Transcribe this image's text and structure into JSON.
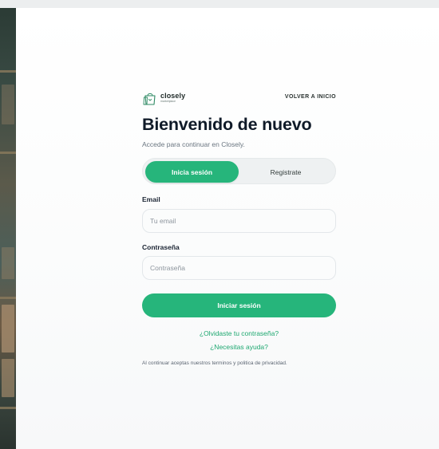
{
  "brand": {
    "name": "closely",
    "tagline": "marketplace",
    "accent_color": "#26b57b",
    "icon": "shopping-bag-icon"
  },
  "header": {
    "back_link": "VOLVER A INICIO"
  },
  "main": {
    "title": "Bienvenido de nuevo",
    "subtitle": "Accede para continuar en Closely."
  },
  "tabs": [
    {
      "label": "Inicia sesión",
      "active": true
    },
    {
      "label": "Registrate",
      "active": false
    }
  ],
  "form": {
    "email": {
      "label": "Email",
      "placeholder": "Tu email",
      "value": ""
    },
    "password": {
      "label": "Contraseña",
      "placeholder": "Contraseña",
      "value": ""
    },
    "submit_label": "Iniciar sesión"
  },
  "links": {
    "forgot_password": "¿Olvidaste tu contraseña?",
    "help": "¿Necesitas ayuda?"
  },
  "footer": {
    "terms": "Al continuar aceptas nuestros terminos y politica de privacidad."
  }
}
